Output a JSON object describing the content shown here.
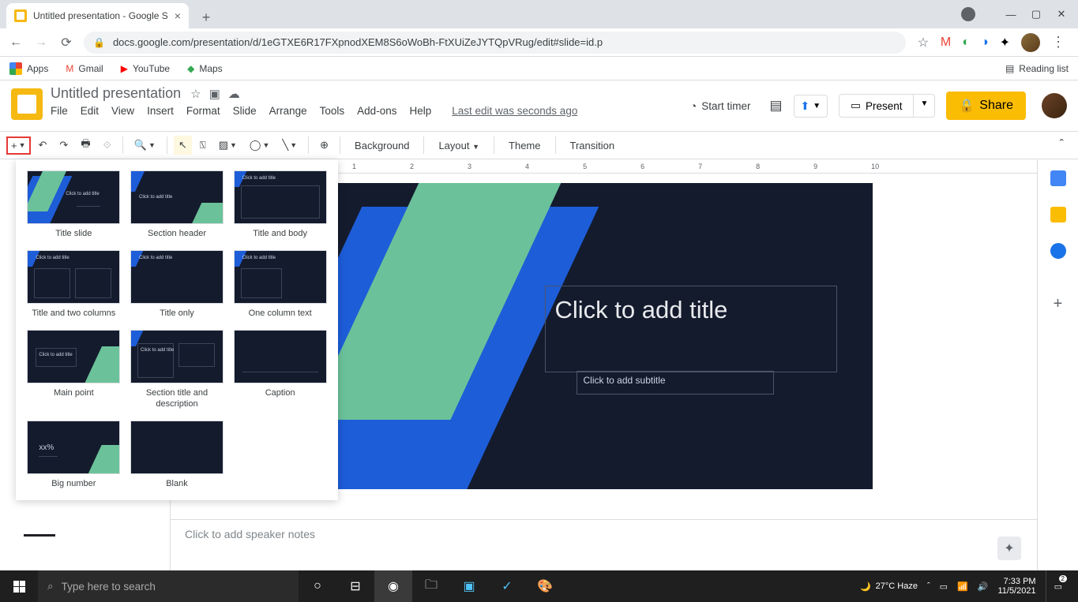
{
  "browser": {
    "tab_title": "Untitled presentation - Google S",
    "url": "docs.google.com/presentation/d/1eGTXE6R17FXpnodXEM8S6oWoBh-FtXUiZeJYTQpVRug/edit#slide=id.p",
    "bookmarks": [
      "Apps",
      "Gmail",
      "YouTube",
      "Maps"
    ],
    "reading_list": "Reading list"
  },
  "app": {
    "doc_title": "Untitled presentation",
    "menus": [
      "File",
      "Edit",
      "View",
      "Insert",
      "Format",
      "Slide",
      "Arrange",
      "Tools",
      "Add-ons",
      "Help"
    ],
    "last_edit": "Last edit was seconds ago",
    "start_timer": "Start timer",
    "present": "Present",
    "share": "Share"
  },
  "toolbar": {
    "background": "Background",
    "layout": "Layout",
    "theme": "Theme",
    "transition": "Transition"
  },
  "layouts": [
    "Title slide",
    "Section header",
    "Title and body",
    "Title and two columns",
    "Title only",
    "One column text",
    "Main point",
    "Section title and description",
    "Caption",
    "Big number",
    "Blank"
  ],
  "layout_thumbs": {
    "click_title": "Click to add title",
    "big_number": "xx%"
  },
  "slide": {
    "title_placeholder": "Click to add title",
    "subtitle_placeholder": "Click to add subtitle"
  },
  "notes": {
    "placeholder": "Click to add speaker notes"
  },
  "ruler": [
    "1",
    "2",
    "3",
    "4",
    "5",
    "6",
    "7",
    "8",
    "9",
    "10"
  ],
  "taskbar": {
    "search_placeholder": "Type here to search",
    "weather": "27°C  Haze",
    "time": "7:33 PM",
    "date": "11/5/2021",
    "notif_count": "2"
  }
}
